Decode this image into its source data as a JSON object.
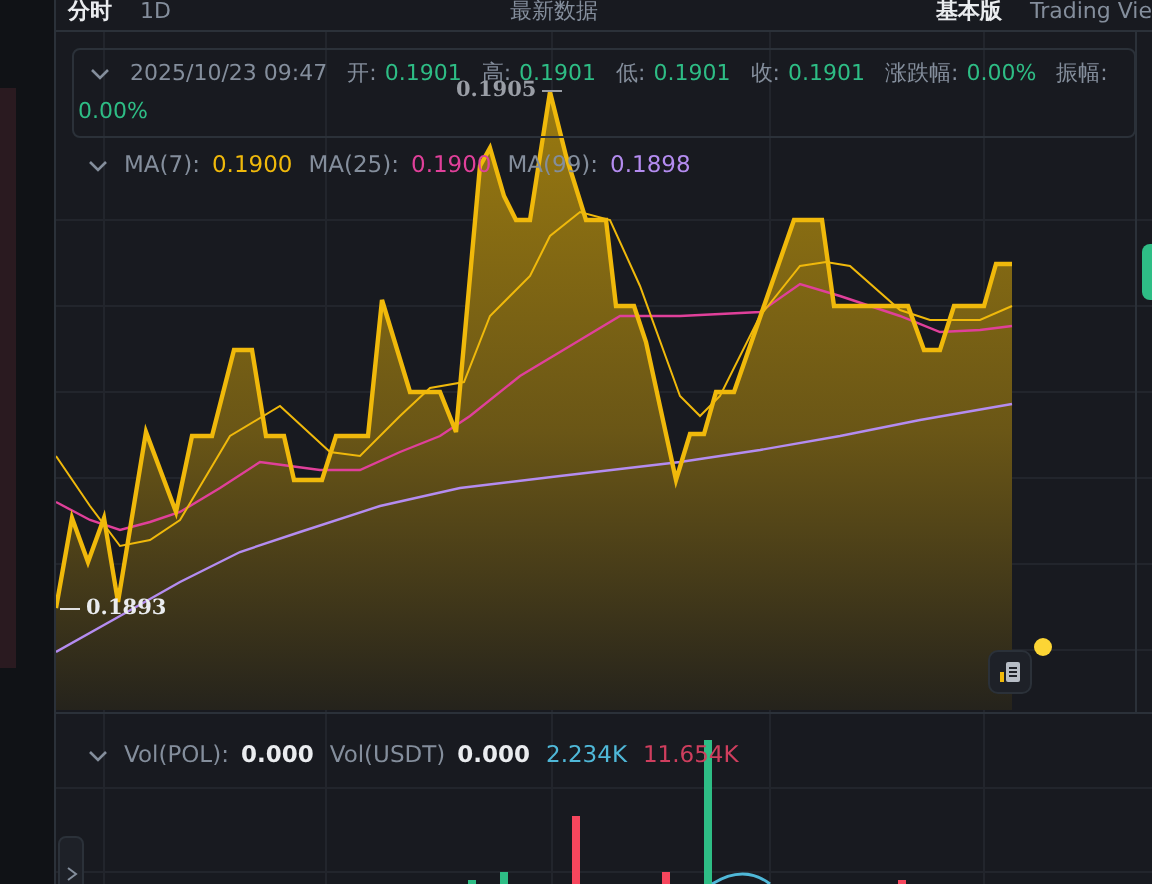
{
  "toolbar": {
    "tabs": [
      {
        "label": "分时",
        "selected": true
      },
      {
        "label": "1D",
        "selected": false
      }
    ],
    "data_label": "最新数据",
    "views": [
      {
        "label": "基本版",
        "selected": true
      },
      {
        "label": "Trading Vie",
        "selected": false
      }
    ]
  },
  "ohlc": {
    "time": "2025/10/23 09:47",
    "fields": [
      {
        "label": "开:",
        "value": "0.1901"
      },
      {
        "label": "高:",
        "value": "0.1901"
      },
      {
        "label": "低:",
        "value": "0.1901"
      },
      {
        "label": "收:",
        "value": "0.1901"
      },
      {
        "label": "涨跌幅:",
        "value": "0.00%"
      },
      {
        "label": "振幅:",
        "value": "0.00%"
      }
    ]
  },
  "ma": [
    {
      "label": "MA(7):",
      "value": "0.1900",
      "color": "#f0b90b"
    },
    {
      "label": "MA(25):",
      "value": "0.1900",
      "color": "#e0409a"
    },
    {
      "label": "MA(99):",
      "value": "0.1898",
      "color": "#b48cf0"
    }
  ],
  "price_labels": {
    "high": "0.1905",
    "low": "0.1893"
  },
  "volume": {
    "items": [
      {
        "label": "Vol(POL):",
        "value": "0.000"
      },
      {
        "label": "Vol(USDT)",
        "value": "0.000"
      }
    ],
    "extra": [
      {
        "value": "2.234K",
        "color": "#4fb8d8"
      },
      {
        "value": "11.654K",
        "color": "#cf3e5e"
      }
    ]
  }
}
